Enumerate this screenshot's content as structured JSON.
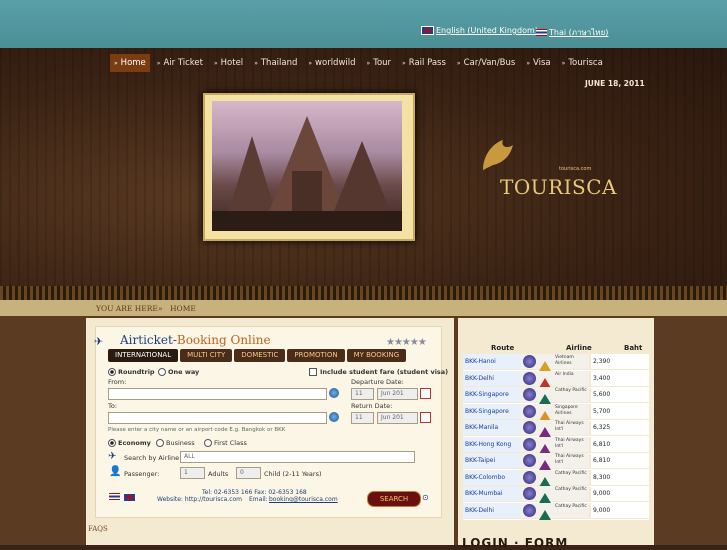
{
  "languages": [
    {
      "label": "English (United Kingdom)",
      "flag": "uk-flag-icon"
    },
    {
      "label": "Thai (ภาษาไทย)",
      "flag": "thai-flag-icon"
    }
  ],
  "nav": [
    "Home",
    "Air Ticket",
    "Hotel",
    "Thailand",
    "worldwild",
    "Tour",
    "Rail Pass",
    "Car/Van/Bus",
    "Visa",
    "Tourisca"
  ],
  "date": "JUNE 18, 2011",
  "logo": {
    "text": "TOURISCA",
    "sub": "tourisca.com"
  },
  "breadcrumb": {
    "prefix": "YOU ARE HERE",
    "sep": "»",
    "current": "HOME"
  },
  "booking": {
    "title_a": "Airticket-",
    "title_b": "Booking Online",
    "tabs": [
      "INTERNATIONAL",
      "MULTI CITY",
      "DOMESTIC",
      "PROMOTION",
      "MY BOOKING"
    ],
    "trip_types": [
      "Roundtrip",
      "One way"
    ],
    "student_label": "Include student fare (student visa)",
    "from_label": "From:",
    "to_label": "To:",
    "departure_label": "Departure Date:",
    "return_label": "Return Date:",
    "dep_day": "11",
    "dep_month": "Jun 201",
    "ret_day": "11",
    "ret_month": "Jun 201",
    "hint": "Please enter a city name or an airport code E.g. Bangkok or BKK",
    "classes": [
      "Economy",
      "Business",
      "First Class"
    ],
    "airline_label": "Search by Airline:",
    "airline_value": "ALL",
    "passenger_label": "Passenger:",
    "adults_value": "1",
    "adults_label": "Adults",
    "child_value": "0",
    "child_label": "Child (2-11 Years)",
    "tel": "Tel: 02-6353 166 Fax: 02-6353 168",
    "website_label": "Website: http://tourisca.com",
    "email_label": "Email:",
    "email": "booking@tourisca.com",
    "search_label": "SEARCH"
  },
  "routes": {
    "headers": [
      "Route",
      "Airline",
      "Baht"
    ],
    "rows": [
      {
        "route": "BKK-Hanoi",
        "airline": "Vietnam Airlines",
        "baht": "2,390",
        "color": "#d6a126"
      },
      {
        "route": "BKK-Delhi",
        "airline": "Air India",
        "baht": "3,400",
        "color": "#c3332a"
      },
      {
        "route": "BKK-Singapore",
        "airline": "Cathay Pacific",
        "baht": "5,600",
        "color": "#1b6b52"
      },
      {
        "route": "BKK-Singapore",
        "airline": "Singapore Airlines",
        "baht": "5,700",
        "color": "#e0902a"
      },
      {
        "route": "BKK-Manila",
        "airline": "Thai Airways Int'l",
        "baht": "6,325",
        "color": "#7a2a80"
      },
      {
        "route": "BKK-Hong Kong",
        "airline": "Thai Airways Int'l",
        "baht": "6,810",
        "color": "#7a2a80"
      },
      {
        "route": "BKK-Taipei",
        "airline": "Thai Airways Int'l",
        "baht": "6,810",
        "color": "#7a2a80"
      },
      {
        "route": "BKK-Colombo",
        "airline": "Cathay Pacific",
        "baht": "8,300",
        "color": "#1b6b52"
      },
      {
        "route": "BKK-Mumbai",
        "airline": "Cathay Pacific",
        "baht": "9,000",
        "color": "#1b6b52"
      },
      {
        "route": "BKK-Delhi",
        "airline": "Cathay Pacific",
        "baht": "9,000",
        "color": "#1b6b52"
      }
    ]
  },
  "faqs": "FAQS",
  "login_title": "LOGIN · FORM"
}
